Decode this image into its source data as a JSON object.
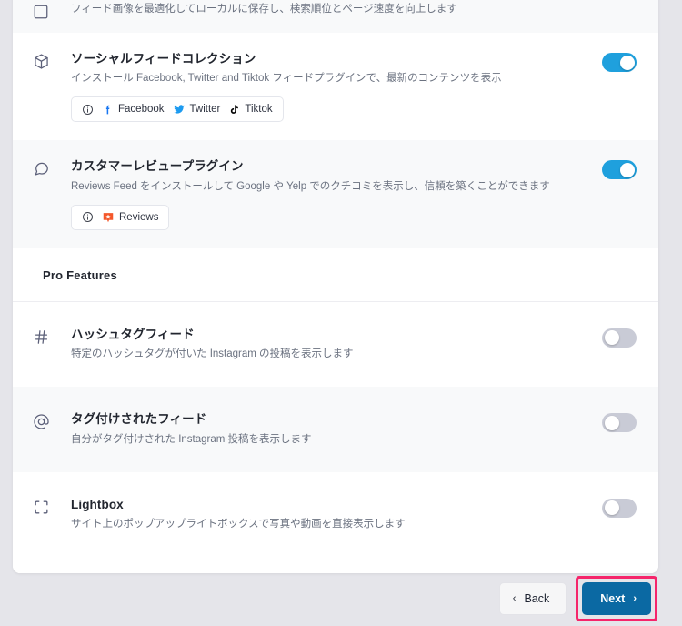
{
  "card": {
    "top_partial_row": {
      "description": "フィード画像を最適化してローカルに保存し、検索順位とページ速度を向上します"
    },
    "features": [
      {
        "icon": "package-box-icon",
        "title": "ソーシャルフィードコレクション",
        "description": "インストール Facebook, Twitter and Tiktok フィードプラグインで、最新のコンテンツを表示",
        "toggle_state": "on",
        "chips": [
          {
            "icon": "info-circle-icon",
            "label": ""
          },
          {
            "icon": "facebook-icon",
            "label": "Facebook"
          },
          {
            "icon": "twitter-icon",
            "label": "Twitter"
          },
          {
            "icon": "tiktok-icon",
            "label": "Tiktok"
          }
        ]
      },
      {
        "icon": "speech-bubble-icon",
        "title": "カスタマーレビュープラグイン",
        "description": "Reviews Feed をインストールして Google や Yelp でのクチコミを表示し、信頼を築くことができます",
        "toggle_state": "on",
        "chips": [
          {
            "icon": "info-circle-icon",
            "label": ""
          },
          {
            "icon": "reviews-feed-icon",
            "label": "Reviews"
          }
        ]
      }
    ],
    "section_header": {
      "label": "Pro Features"
    },
    "pro_features": [
      {
        "icon": "hashtag-icon",
        "title": "ハッシュタグフィード",
        "description": "特定のハッシュタグが付いた Instagram の投稿を表示します",
        "toggle_state": "off"
      },
      {
        "icon": "at-sign-icon",
        "title": "タグ付けされたフィード",
        "description": "自分がタグ付けされた Instagram 投稿を表示します",
        "toggle_state": "off"
      },
      {
        "icon": "lightbox-expand-icon",
        "title": "Lightbox",
        "description": "サイト上のポップアップライトボックスで写真や動画を直接表示します",
        "toggle_state": "off"
      }
    ]
  },
  "footer": {
    "back_label": "Back",
    "back_chevron": "‹",
    "next_label": "Next",
    "next_chevron": "›"
  },
  "colors": {
    "page_background": "#e5e5ea",
    "card_background": "#ffffff",
    "row_shaded": "#f8f9fa",
    "toggle_on": "#1fa0dd",
    "toggle_off": "#c9cbd6",
    "next_button": "#0b69a3",
    "highlight_border": "#f5256b",
    "title_text": "#22262f",
    "desc_text": "#6b7280",
    "icon_grey": "#5c6079",
    "facebook_blue": "#1877f2",
    "twitter_blue": "#1d9bf0",
    "tiktok_black": "#010101",
    "reviews_orange": "#f4572a"
  }
}
